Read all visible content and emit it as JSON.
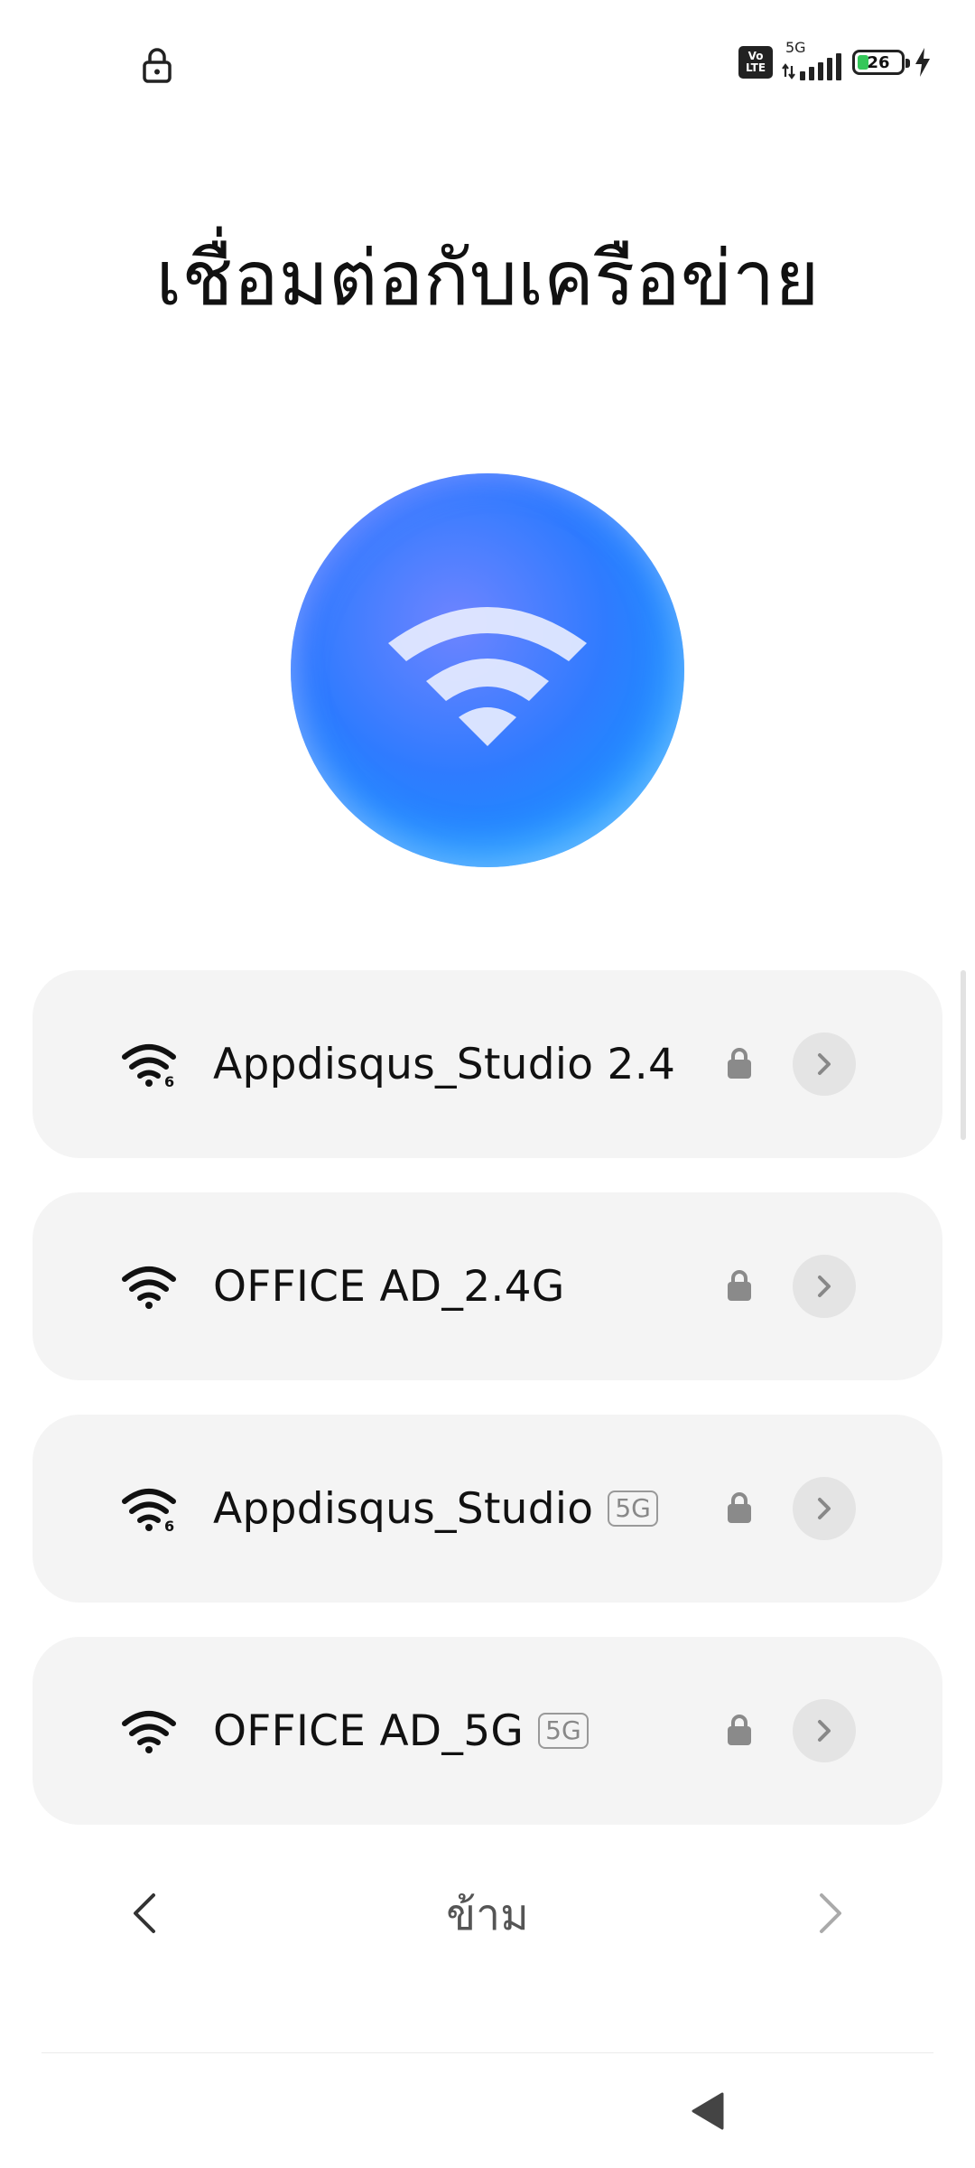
{
  "status_bar": {
    "volte_line1": "Vo",
    "volte_line2": "LTE",
    "network_type": "5G",
    "battery_level": "26",
    "battery_fraction": 0.26,
    "icons": [
      "lock-icon",
      "volte-icon",
      "signal-icon",
      "battery-icon",
      "charging-bolt-icon"
    ]
  },
  "title": "เชื่อมต่อกับเครือข่าย",
  "hero": {
    "icon": "wifi-icon"
  },
  "networks": [
    {
      "ssid": "Appdisqus_Studio 2.4",
      "band": "",
      "wifi_icon": "wifi-6-icon",
      "secured": true
    },
    {
      "ssid": "OFFICE AD_2.4G",
      "band": "",
      "wifi_icon": "wifi-icon",
      "secured": true
    },
    {
      "ssid": "Appdisqus_Studio",
      "band": "5G",
      "wifi_icon": "wifi-6-icon",
      "secured": true
    },
    {
      "ssid": "OFFICE AD_5G",
      "band": "5G",
      "wifi_icon": "wifi-icon",
      "secured": true
    }
  ],
  "footer": {
    "skip_label": "ข้าม",
    "back_icon": "chevron-left-icon",
    "next_icon": "chevron-right-icon"
  },
  "colors": {
    "card_bg": "#f4f4f4",
    "hero_blue": "#2f7bff",
    "text": "#111111",
    "muted": "#888888"
  }
}
